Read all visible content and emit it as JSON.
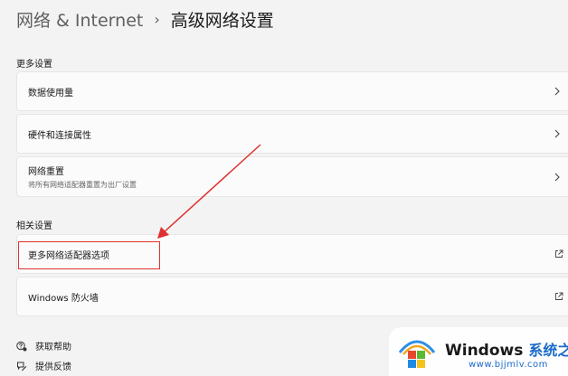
{
  "breadcrumb": {
    "parent": "网络 & Internet",
    "separator": "›",
    "current": "高级网络设置"
  },
  "sections": {
    "more": "更多设置",
    "related": "相关设置"
  },
  "more_items": [
    {
      "title": "数据使用量",
      "icon": "chevron-right-icon"
    },
    {
      "title": "硬件和连接属性",
      "icon": "chevron-right-icon"
    },
    {
      "title": "网络重置",
      "subtitle": "将所有网络适配器重置为出厂设置",
      "icon": "chevron-right-icon"
    }
  ],
  "related_items": [
    {
      "title": "更多网络适配器选项",
      "icon": "external-link-icon"
    },
    {
      "title": "Windows 防火墙",
      "icon": "external-link-icon"
    }
  ],
  "help": [
    {
      "label": "获取帮助",
      "icon": "help-icon"
    },
    {
      "label": "提供反馈",
      "icon": "feedback-icon"
    }
  ],
  "annotation": {
    "color": "#e03131"
  },
  "watermark": {
    "brand": "Windows",
    "brand_cn": "系统之家",
    "url": "www.bjjmlv.com"
  }
}
